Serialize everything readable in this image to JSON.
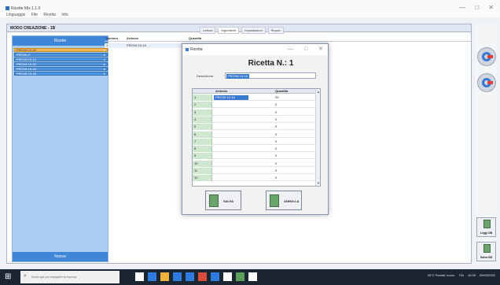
{
  "window": {
    "title": "Ricette Mix 1.1.0",
    "menu": [
      "Linguaggio",
      "File",
      "Ricetta",
      "Info"
    ],
    "controls": [
      "—",
      "□",
      "✕"
    ]
  },
  "header": {
    "title": "MODO CREAZIONE - 1B",
    "tabs": [
      "Lettura",
      "Ingredienti",
      "Impostazioni",
      "Report"
    ]
  },
  "left_panel": {
    "header": "Ricette",
    "items": [
      "PROVA 10-16",
      "PROVA 2",
      "PROVA 10-13",
      "PROVA 10-20",
      "PROVA 10-16",
      "PROVA 10-18"
    ],
    "footer": "Nuova"
  },
  "center_table": {
    "columns": [
      "Numero",
      "Articolo",
      "Quantita"
    ],
    "row": {
      "num": "1",
      "name": "PROVA 10-16"
    }
  },
  "dialog": {
    "title": "Ricetta",
    "heading_prefix": "Ricetta N.:",
    "heading_number": "1",
    "description_label": "Descrizione:",
    "description_value": "PROVA 10-16",
    "grid_headers": [
      "",
      "Articolo",
      "Quantita"
    ],
    "rows": [
      {
        "num": "1",
        "name": "PROVA 10-16",
        "qty": "25"
      },
      {
        "num": "2",
        "name": "",
        "qty": "0"
      },
      {
        "num": "3",
        "name": "",
        "qty": "0"
      },
      {
        "num": "4",
        "name": "",
        "qty": "0"
      },
      {
        "num": "5",
        "name": "",
        "qty": "0"
      },
      {
        "num": "6",
        "name": "",
        "qty": "0"
      },
      {
        "num": "7",
        "name": "",
        "qty": "0"
      },
      {
        "num": "8",
        "name": "",
        "qty": "0"
      },
      {
        "num": "9",
        "name": "",
        "qty": "0"
      },
      {
        "num": "10",
        "name": "",
        "qty": "0"
      },
      {
        "num": "11",
        "name": "",
        "qty": "0"
      },
      {
        "num": "12",
        "name": "",
        "qty": "0"
      }
    ],
    "save_label": "SALVA",
    "cancel_label": "ANNULLA"
  },
  "right_bar": {
    "load_label": "Leggi DB",
    "save_label": "Salva DB"
  },
  "taskbar": {
    "search_placeholder": "Scrivi qui per eseguire la ricerca",
    "tray": [
      "16°C Parzial. nuvol.",
      "ITA",
      "10:05",
      "09/03/2022"
    ],
    "icon_colors": [
      "#ffffff",
      "#2f7de1",
      "#f0b23a",
      "#2f7de1",
      "#2f7de1",
      "#d94b3a",
      "#2f7de1",
      "#ffffff",
      "#5aa05a",
      "#ffffff"
    ]
  }
}
